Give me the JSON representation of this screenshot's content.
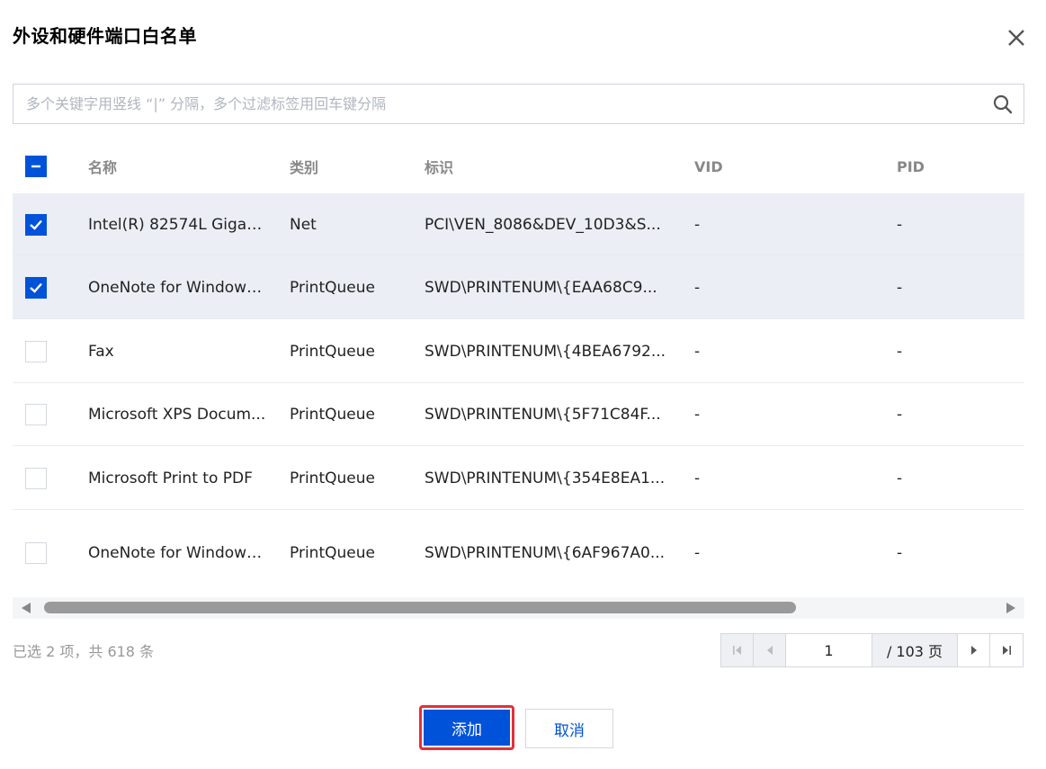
{
  "dialog": {
    "title": "外设和硬件端口白名单"
  },
  "search": {
    "placeholder": "多个关键字用竖线 “|” 分隔，多个过滤标签用回车键分隔"
  },
  "table": {
    "columns": [
      "名称",
      "类别",
      "标识",
      "VID",
      "PID"
    ],
    "rows": [
      {
        "checked": true,
        "name": "Intel(R) 82574L Gigab...",
        "type": "Net",
        "id": "PCI\\VEN_8086&DEV_10D3&S...",
        "vid": "-",
        "pid": "-"
      },
      {
        "checked": true,
        "name": "OneNote for Windows...",
        "type": "PrintQueue",
        "id": "SWD\\PRINTENUM\\{EAA68C9...",
        "vid": "-",
        "pid": "-"
      },
      {
        "checked": false,
        "name": "Fax",
        "type": "PrintQueue",
        "id": "SWD\\PRINTENUM\\{4BEA6792...",
        "vid": "-",
        "pid": "-"
      },
      {
        "checked": false,
        "name": "Microsoft XPS Docum...",
        "type": "PrintQueue",
        "id": "SWD\\PRINTENUM\\{5F71C84F...",
        "vid": "-",
        "pid": "-"
      },
      {
        "checked": false,
        "name": "Microsoft Print to PDF",
        "type": "PrintQueue",
        "id": "SWD\\PRINTENUM\\{354E8EA1...",
        "vid": "-",
        "pid": "-"
      },
      {
        "checked": false,
        "name": "OneNote for Windows...",
        "type": "PrintQueue",
        "id": "SWD\\PRINTENUM\\{6AF967A0...",
        "vid": "-",
        "pid": "-"
      }
    ]
  },
  "summary": "已选 2 项，共 618 条",
  "pagination": {
    "current_page": "1",
    "total_label": "/ 103 页"
  },
  "footer": {
    "add_label": "添加",
    "cancel_label": "取消"
  },
  "colors": {
    "primary": "#0052d9",
    "highlight_border": "#e2303a",
    "selected_row": "#ebeef4"
  }
}
